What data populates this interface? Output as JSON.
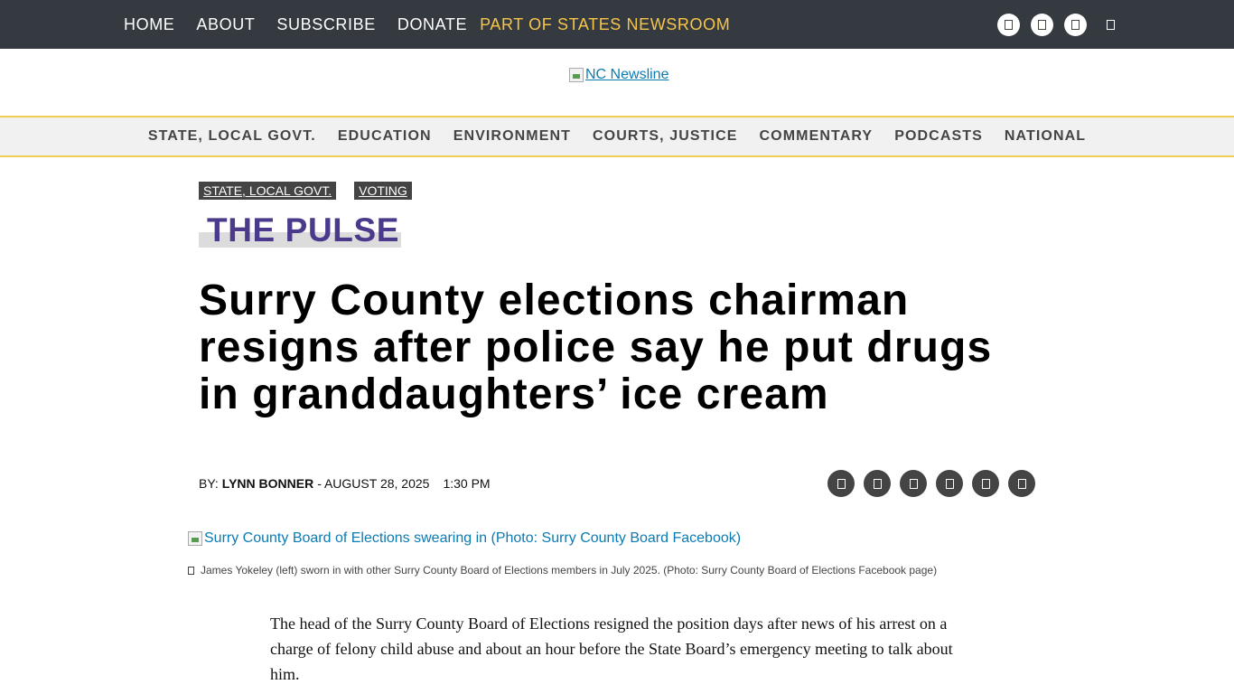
{
  "top_nav": {
    "items": [
      "HOME",
      "ABOUT",
      "SUBSCRIBE",
      "DONATE"
    ],
    "network_link": "PART OF STATES NEWSROOM",
    "icons": [
      "facebook-icon",
      "x-icon",
      "instagram-icon",
      "search-icon"
    ]
  },
  "logo": {
    "alt": "NC Newsline"
  },
  "section_nav": [
    "STATE, LOCAL GOVT.",
    "EDUCATION",
    "ENVIRONMENT",
    "COURTS, JUSTICE",
    "COMMENTARY",
    "PODCASTS",
    "NATIONAL"
  ],
  "article": {
    "tags": [
      "STATE, LOCAL GOVT.",
      "VOTING"
    ],
    "column": "THE PULSE",
    "headline": "Surry County elections chairman resigns after police say he put drugs in granddaughters’ ice cream",
    "byline_prefix": "BY:",
    "author": "LYNN BONNER",
    "date": "- AUGUST 28, 2025",
    "time": "1:30 PM",
    "share_icons": [
      "facebook-icon",
      "x-icon",
      "email-icon",
      "reddit-icon",
      "linkedin-icon",
      "print-icon"
    ],
    "image_alt": "Surry County Board of Elections swearing in (Photo: Surry County Board Facebook)",
    "caption": "James Yokeley (left) sworn in with other Surry County Board of Elections members in July 2025. (Photo: Surry County Board of Elections Facebook page)",
    "body": "The head of the Surry County Board of Elections resigned the position days after news of his arrest on a charge of felony child abuse and about an hour before the State Board’s emergency meeting to talk about him."
  }
}
